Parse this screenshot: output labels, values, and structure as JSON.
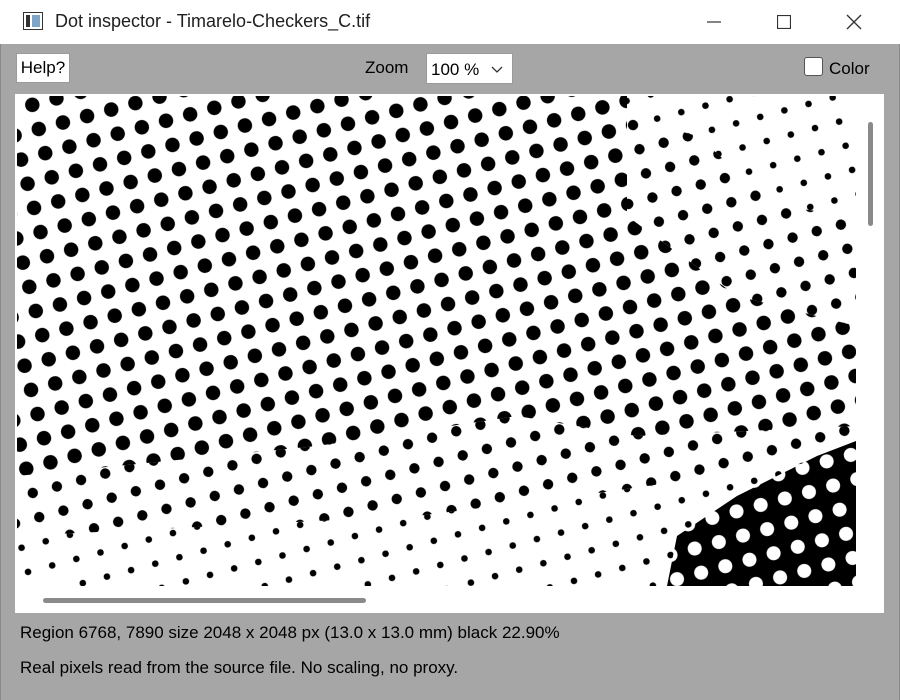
{
  "window": {
    "title": "Dot inspector - Timarelo-Checkers_C.tif",
    "minimize_icon": "minimize-icon",
    "maximize_icon": "maximize-icon",
    "close_icon": "close-icon"
  },
  "toolbar": {
    "help_label": "Help?",
    "zoom_label": "Zoom",
    "zoom_value": "100 %",
    "color_label": "Color",
    "color_checked": false
  },
  "status": {
    "line1": "Region 6768, 7890  size 2048 x 2048 px  (13.0 x 13.0 mm)  black 22.90%",
    "line2": "Real pixels read from the source file. No scaling, no proxy."
  }
}
